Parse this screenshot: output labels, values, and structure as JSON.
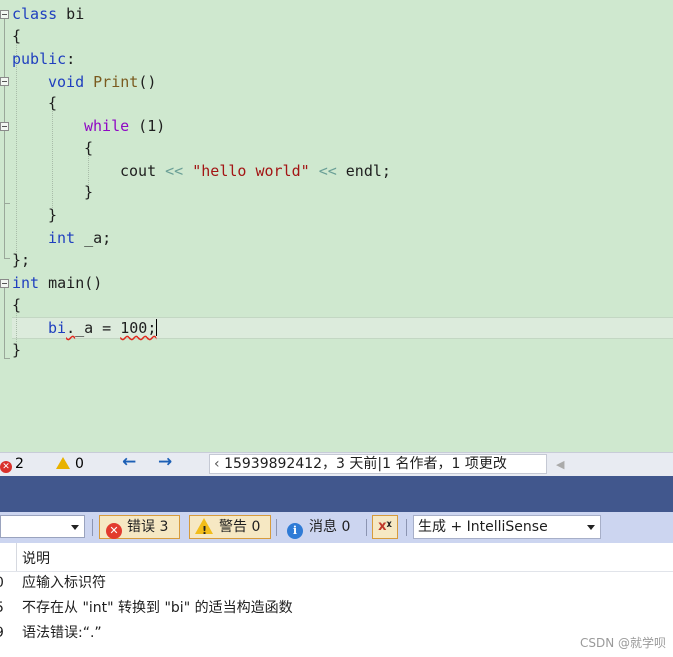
{
  "editor": {
    "lines": {
      "l1": {
        "kw": "class",
        "rest": " bi"
      },
      "l2": {
        "text": "{"
      },
      "l3": {
        "kw": "public",
        "rest": ":"
      },
      "l4": {
        "kw": "void",
        "fn": "Print",
        "rest": "()"
      },
      "l5": {
        "text": "{"
      },
      "l6": {
        "kw": "while",
        "rest": " (1)"
      },
      "l7": {
        "text": "{"
      },
      "l8": {
        "ident": "cout",
        "op1": "<<",
        "str": "\"hello world\"",
        "op2": "<<",
        "rest": "endl;"
      },
      "l9": {
        "text": "}"
      },
      "l10": {
        "text": "}"
      },
      "l11": {
        "kw": "int",
        "rest": " _a;"
      },
      "l12": {
        "text": "};"
      },
      "l13": {
        "kw": "int",
        "rest": " main()"
      },
      "l14": {
        "text": "{"
      },
      "l15": {
        "obj": "bi",
        "dot": ".",
        "rest": "_a = ",
        "num": "100;"
      },
      "l16": {
        "text": "}"
      }
    }
  },
  "status": {
    "errors": "2",
    "warnings": "0",
    "back_icon": "arrow-left-icon",
    "forward_icon": "arrow-right-icon",
    "blame": "15939892412，3 天前|1 名作者，1 项更改"
  },
  "toolbar": {
    "errors_label": "错误 3",
    "warnings_label": "警告 0",
    "messages_label": "消息 0",
    "filter_glyph": "ᵡ",
    "build_label": "生成 + IntelliSense"
  },
  "list": {
    "header": "说明",
    "rows": [
      {
        "code": "0",
        "desc": "应输入标识符"
      },
      {
        "code": "5",
        "desc": "不存在从 \"int\" 转换到 \"bi\" 的适当构造函数"
      },
      {
        "code": "9",
        "desc": "语法错误:“.”"
      }
    ],
    "watermark": "CSDN @就学呗"
  },
  "colors": {
    "editor_bg": "#cfe8cf",
    "keyword": "#1f3fbf",
    "string": "#a31515",
    "error": "#d9312b",
    "band": "#41578d"
  }
}
